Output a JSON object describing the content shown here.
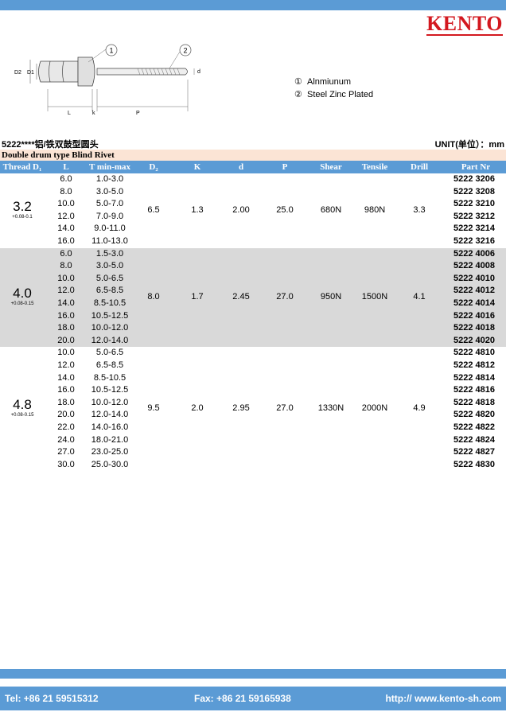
{
  "brand": {
    "logo": "KENTO"
  },
  "legend": [
    {
      "num": "①",
      "text": "Alnmiunum"
    },
    {
      "num": "②",
      "text": "Steel Zinc Plated"
    }
  ],
  "diagram": {
    "labels": {
      "d2": "D2",
      "d1": "D1",
      "l": "L",
      "k": "k",
      "p": "P",
      "d": "d",
      "c1": "1",
      "c2": "2"
    }
  },
  "header": {
    "title": "5222****铝/铁双鼓型圆头",
    "unit": "UNIT(单位）：mm",
    "subtitle": "Double drum type Blind Rivet"
  },
  "columns": [
    "Thread D₁",
    "L",
    "T min-max",
    "D₂",
    "K",
    "d",
    "P",
    "Shear",
    "Tensile",
    "Drill",
    "Part Nr"
  ],
  "groups": [
    {
      "thread": "3.2",
      "tol": "+0.08-0.1",
      "d2": "6.5",
      "k": "1.3",
      "d": "2.00",
      "p": "25.0",
      "shear": "680N",
      "tensile": "980N",
      "drill": "3.3",
      "rows": [
        [
          "6.0",
          "1.0-3.0",
          "5222 3206"
        ],
        [
          "8.0",
          "3.0-5.0",
          "5222 3208"
        ],
        [
          "10.0",
          "5.0-7.0",
          "5222 3210"
        ],
        [
          "12.0",
          "7.0-9.0",
          "5222 3212"
        ],
        [
          "14.0",
          "9.0-11.0",
          "5222 3214"
        ],
        [
          "16.0",
          "11.0-13.0",
          "5222 3216"
        ]
      ]
    },
    {
      "thread": "4.0",
      "tol": "+0.08-0.15",
      "d2": "8.0",
      "k": "1.7",
      "d": "2.45",
      "p": "27.0",
      "shear": "950N",
      "tensile": "1500N",
      "drill": "4.1",
      "rows": [
        [
          "6.0",
          "1.5-3.0",
          "5222 4006"
        ],
        [
          "8.0",
          "3.0-5.0",
          "5222 4008"
        ],
        [
          "10.0",
          "5.0-6.5",
          "5222 4010"
        ],
        [
          "12.0",
          "6.5-8.5",
          "5222 4012"
        ],
        [
          "14.0",
          "8.5-10.5",
          "5222 4014"
        ],
        [
          "16.0",
          "10.5-12.5",
          "5222 4016"
        ],
        [
          "18.0",
          "10.0-12.0",
          "5222 4018"
        ],
        [
          "20.0",
          "12.0-14.0",
          "5222 4020"
        ]
      ]
    },
    {
      "thread": "4.8",
      "tol": "+0.08-0.15",
      "d2": "9.5",
      "k": "2.0",
      "d": "2.95",
      "p": "27.0",
      "shear": "1330N",
      "tensile": "2000N",
      "drill": "4.9",
      "rows": [
        [
          "10.0",
          "5.0-6.5",
          "5222 4810"
        ],
        [
          "12.0",
          "6.5-8.5",
          "5222 4812"
        ],
        [
          "14.0",
          "8.5-10.5",
          "5222 4814"
        ],
        [
          "16.0",
          "10.5-12.5",
          "5222 4816"
        ],
        [
          "18.0",
          "10.0-12.0",
          "5222 4818"
        ],
        [
          "20.0",
          "12.0-14.0",
          "5222 4820"
        ],
        [
          "22.0",
          "14.0-16.0",
          "5222 4822"
        ],
        [
          "24.0",
          "18.0-21.0",
          "5222 4824"
        ],
        [
          "27.0",
          "23.0-25.0",
          "5222 4827"
        ],
        [
          "30.0",
          "25.0-30.0",
          "5222 4830"
        ]
      ]
    }
  ],
  "footer": {
    "tel": "Tel: +86 21 59515312",
    "fax": "Fax: +86 21 59165938",
    "web": "http:// www.kento-sh.com"
  }
}
